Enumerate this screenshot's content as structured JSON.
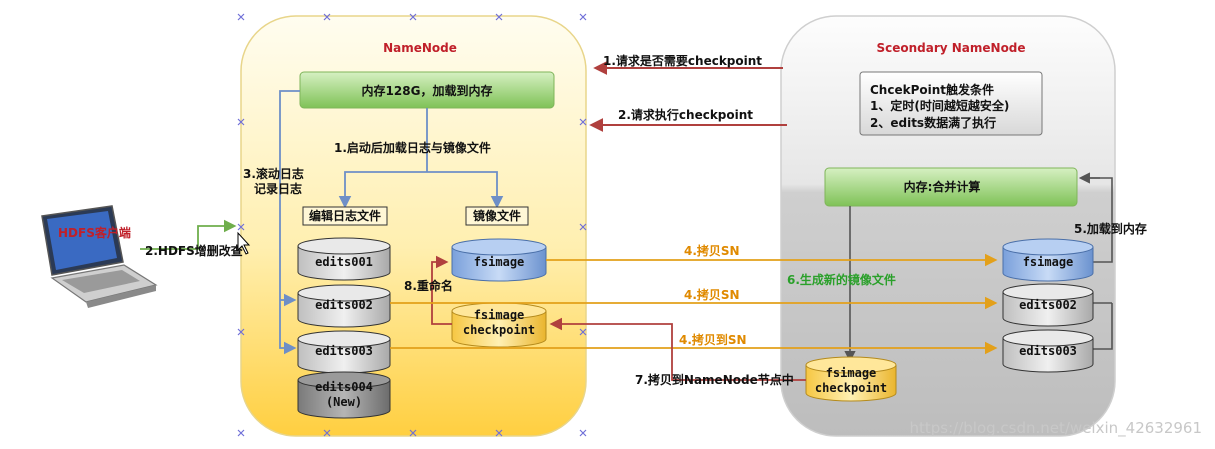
{
  "colors": {
    "namenode_panel_top": "#fffbe6",
    "namenode_panel_bottom": "#ffd24a",
    "secondary_panel_top": "#fafafa",
    "secondary_panel_bottom": "#bdbdbd",
    "memory_box": "#9fd67a",
    "cylinder_gray": "#d0d0d0",
    "cylinder_dark": "#8a8a8a",
    "cylinder_blue": "#86a9e0",
    "cylinder_yellow": "#ffd966",
    "arrow_red": "#b0403e",
    "arrow_blue": "#6e8fc7",
    "arrow_orange": "#e3a01a",
    "arrow_green": "#6fae4c",
    "arrow_gray": "#555555",
    "title_red": "#c0202a"
  },
  "client": {
    "label": "HDFS客户端",
    "icon": "laptop-icon"
  },
  "namenode": {
    "title": "NameNode",
    "memory_box": "内存128G，加载到内存",
    "step1_label": "1.启动后加载日志与镜像文件",
    "step3_label_line1": "3.滚动日志",
    "step3_label_line2": "记录日志",
    "edit_log_header": "编辑日志文件",
    "image_header": "镜像文件",
    "edits": [
      {
        "name": "edits001"
      },
      {
        "name": "edits002"
      },
      {
        "name": "edits003"
      }
    ],
    "edits_new_line1": "edits004",
    "edits_new_line2": "(New)",
    "fsimage": "fsimage",
    "fsimage_ckpt_line1": "fsimage",
    "fsimage_ckpt_line2": "checkpoint",
    "rename_label": "8.重命名"
  },
  "secondary": {
    "title": "Sceondary NameNode",
    "trigger_line1": "ChcekPoint触发条件",
    "trigger_line2": "1、定时(时间越短越安全)",
    "trigger_line3": "2、edits数据满了执行",
    "memory_box": "内存:合并计算",
    "load_label": "5.加载到内存",
    "fsimage": "fsimage",
    "edits": [
      {
        "name": "edits002"
      },
      {
        "name": "edits003"
      }
    ],
    "ckpt_line1": "fsimage",
    "ckpt_line2": "checkpoint",
    "new_image_label": "6.生成新的镜像文件"
  },
  "arrows": {
    "request1": "1.请求是否需要checkpoint",
    "request2": "2.请求执行checkpoint",
    "client_op": "2.HDFS增删改查",
    "copy_fsimage": "4.拷贝SN",
    "copy_edits002": "4.拷贝SN",
    "copy_edits003": "4.拷贝到SN",
    "copy_back": "7.拷贝到NameNode节点中"
  },
  "watermark": "https://blog.csdn.net/weixin_42632961"
}
